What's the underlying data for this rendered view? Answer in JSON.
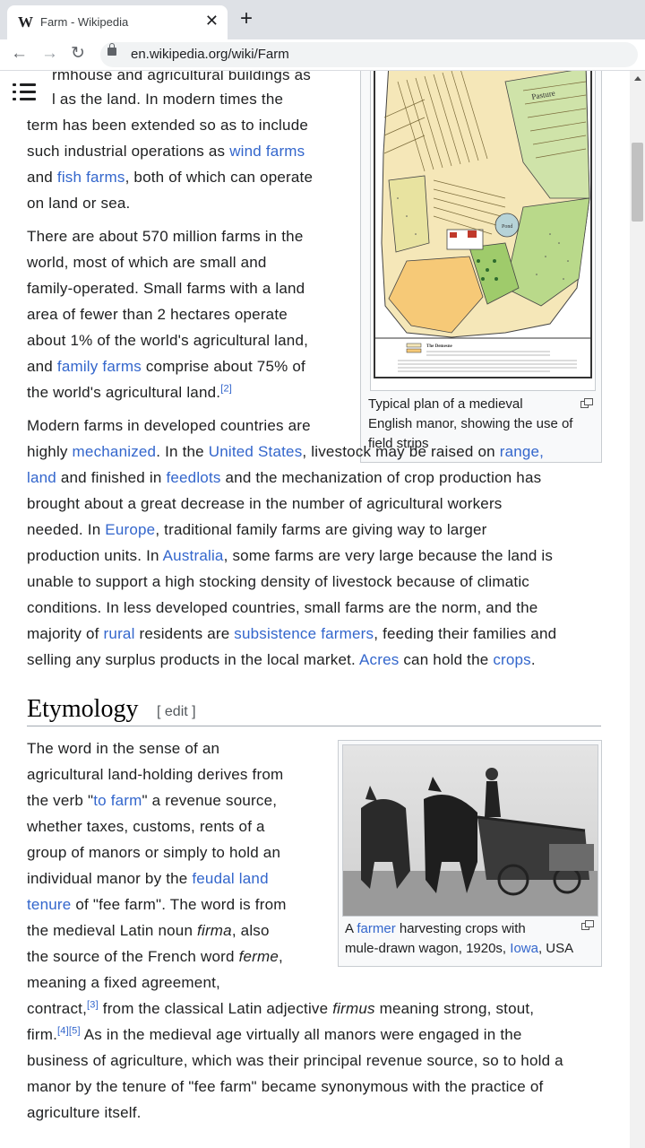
{
  "browser": {
    "tab_favicon": "W",
    "tab_title": "Farm - Wikipedia",
    "tab_close": "✕",
    "new_tab": "+",
    "url": "en.wikipedia.org/wiki/Farm",
    "icons": {
      "back": "←",
      "forward": "→",
      "reload": "↻"
    }
  },
  "article": {
    "intro_p1": {
      "l1": "rmhouse and agricultural buildings as",
      "l2": "l as the land. In modern times the",
      "l3": "term has been extended so as to include",
      "l4_a": "such industrial operations as ",
      "l4_link": "wind farms",
      "l5_a": "and ",
      "l5_link": "fish farms",
      "l5_b": ", both of which can operate",
      "l6": "on land or sea."
    },
    "intro_p2": {
      "l1": "There are about 570 million farms in the",
      "l2": "world, most of which are small and",
      "l3": "family-operated. Small farms with a land",
      "l4": "area of fewer than 2 hectares operate",
      "l5": "about 1% of the world's agricultural land,",
      "l6_a": "and ",
      "l6_link": "family farms",
      "l6_b": " comprise about 75% of",
      "l7": "the world's agricultural land.",
      "l7_ref": "[2]"
    },
    "intro_p3": {
      "l1": "Modern farms in developed countries are",
      "l2_a": "highly ",
      "l2_link1": "mechanized",
      "l2_b": ". In the ",
      "l2_link2": "United States",
      "l2_c": ", livestock may be raised on ",
      "l2_link3": "range,",
      "l3_link": "land",
      "l3_a": " and finished in ",
      "l3_link2": "feedlots",
      "l3_b": " and the mechanization of crop production has",
      "l4": "brought about a great decrease in the number of agricultural workers",
      "l5_a": "needed. In ",
      "l5_link": "Europe",
      "l5_b": ", traditional family farms are giving way to larger",
      "l6_a": "production units. In ",
      "l6_link": "Australia",
      "l6_b": ", some farms are very large because the land is",
      "l7": "unable to support a high stocking density of livestock because of climatic",
      "l8": "conditions. In less developed countries, small farms are the norm, and the",
      "l9_a": "majority of ",
      "l9_link": "rural",
      "l9_b": " residents are ",
      "l9_link2": "subsistence farmers",
      "l9_c": ", feeding their families and",
      "l10_a": "selling any surplus products in the local market. ",
      "l10_link": "Acres",
      "l10_b": " can hold the ",
      "l10_link2": "crops",
      "l10_c": "."
    },
    "map_caption": {
      "l1": "Typical plan of a medieval",
      "l2": "English manor, showing the use of",
      "l3": "field strips"
    },
    "map_labels": {
      "pasture": "Pasture",
      "pond": "Pond",
      "legend_title": "The Demesne"
    },
    "etymology": {
      "heading": "Etymology",
      "edit": "[ edit ]",
      "l1": "The word in the sense of an",
      "l2": "agricultural land-holding derives from",
      "l3_a": "the verb \"",
      "l3_link": "to farm",
      "l3_b": "\" a revenue source,",
      "l4": "whether taxes, customs, rents of a",
      "l5": "group of manors or simply to hold an",
      "l6_a": "individual manor by the ",
      "l6_link": "feudal land",
      "l7_link": "tenure",
      "l7_a": " of \"fee farm\". The word is from",
      "l8_a": "the medieval Latin noun ",
      "l8_i": "firma",
      "l8_b": ", also",
      "l9_a": "the source of the French word ",
      "l9_i": "ferme",
      "l9_b": ",",
      "l10": "meaning a fixed agreement,",
      "l11_a": "contract,",
      "l11_ref": "[3]",
      "l11_b": " from the classical Latin adjective ",
      "l11_i": "firmus",
      "l11_c": " meaning strong, stout,",
      "l12_a": "firm.",
      "l12_ref": "[4][5]",
      "l12_b": " As in the medieval age virtually all manors were engaged in the",
      "l13": "business of agriculture, which was their principal revenue source, so to hold a",
      "l14": "manor by the tenure of \"fee farm\" became synonymous with the practice of",
      "l15": "agriculture itself."
    },
    "photo_caption": {
      "a": "A ",
      "link1": "farmer",
      "b": " harvesting crops with",
      "c": "mule-drawn wagon, 1920s, ",
      "link2": "Iowa",
      "d": ", USA"
    }
  },
  "colors": {
    "link": "#3366cc",
    "text": "#202122"
  }
}
